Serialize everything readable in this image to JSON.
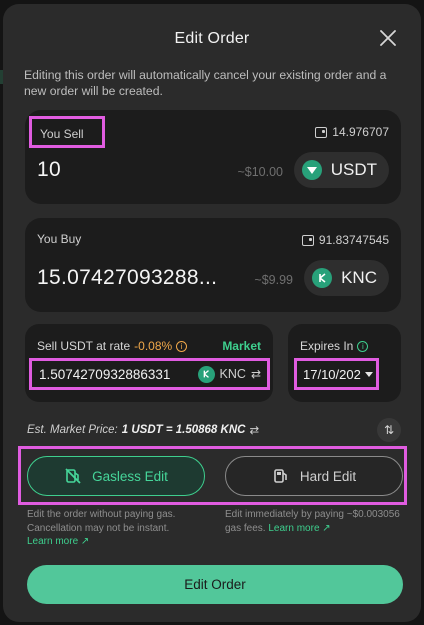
{
  "modal": {
    "title": "Edit Order",
    "notice": "Editing this order will automatically cancel your existing order and a new order will be created."
  },
  "sell": {
    "label": "You Sell",
    "balance": "14.976707",
    "amount": "10",
    "usd_value": "~$10.00",
    "token": "USDT",
    "token_icon": "tether-icon"
  },
  "buy": {
    "label": "You Buy",
    "balance": "91.83747545",
    "amount": "15.07427093288...",
    "usd_value": "~$9.99",
    "token": "KNC",
    "token_icon": "kyber-icon"
  },
  "rate": {
    "prefix": "Sell USDT at rate",
    "delta": "-0.08%",
    "market_label": "Market",
    "value": "1.5074270932886331",
    "token": "KNC"
  },
  "expires": {
    "label": "Expires In",
    "value": "17/10/202"
  },
  "estimate": {
    "label": "Est. Market Price:",
    "value": "1 USDT = 1.50868 KNC"
  },
  "modes": {
    "gasless": {
      "label": "Gasless Edit",
      "desc": "Edit the order without paying gas. Cancellation may not be instant.",
      "learn": "Learn more ↗"
    },
    "hard": {
      "label": "Hard Edit",
      "desc": "Edit immediately by paying ~$0.003056 gas fees.",
      "learn": "Learn more ↗"
    }
  },
  "submit_label": "Edit Order",
  "colors": {
    "accent": "#3ecf8e",
    "warning": "#f0a84a",
    "highlight": "#e05ce0",
    "modal_bg": "#2b2b2b",
    "card_bg": "#1c1c1c"
  }
}
